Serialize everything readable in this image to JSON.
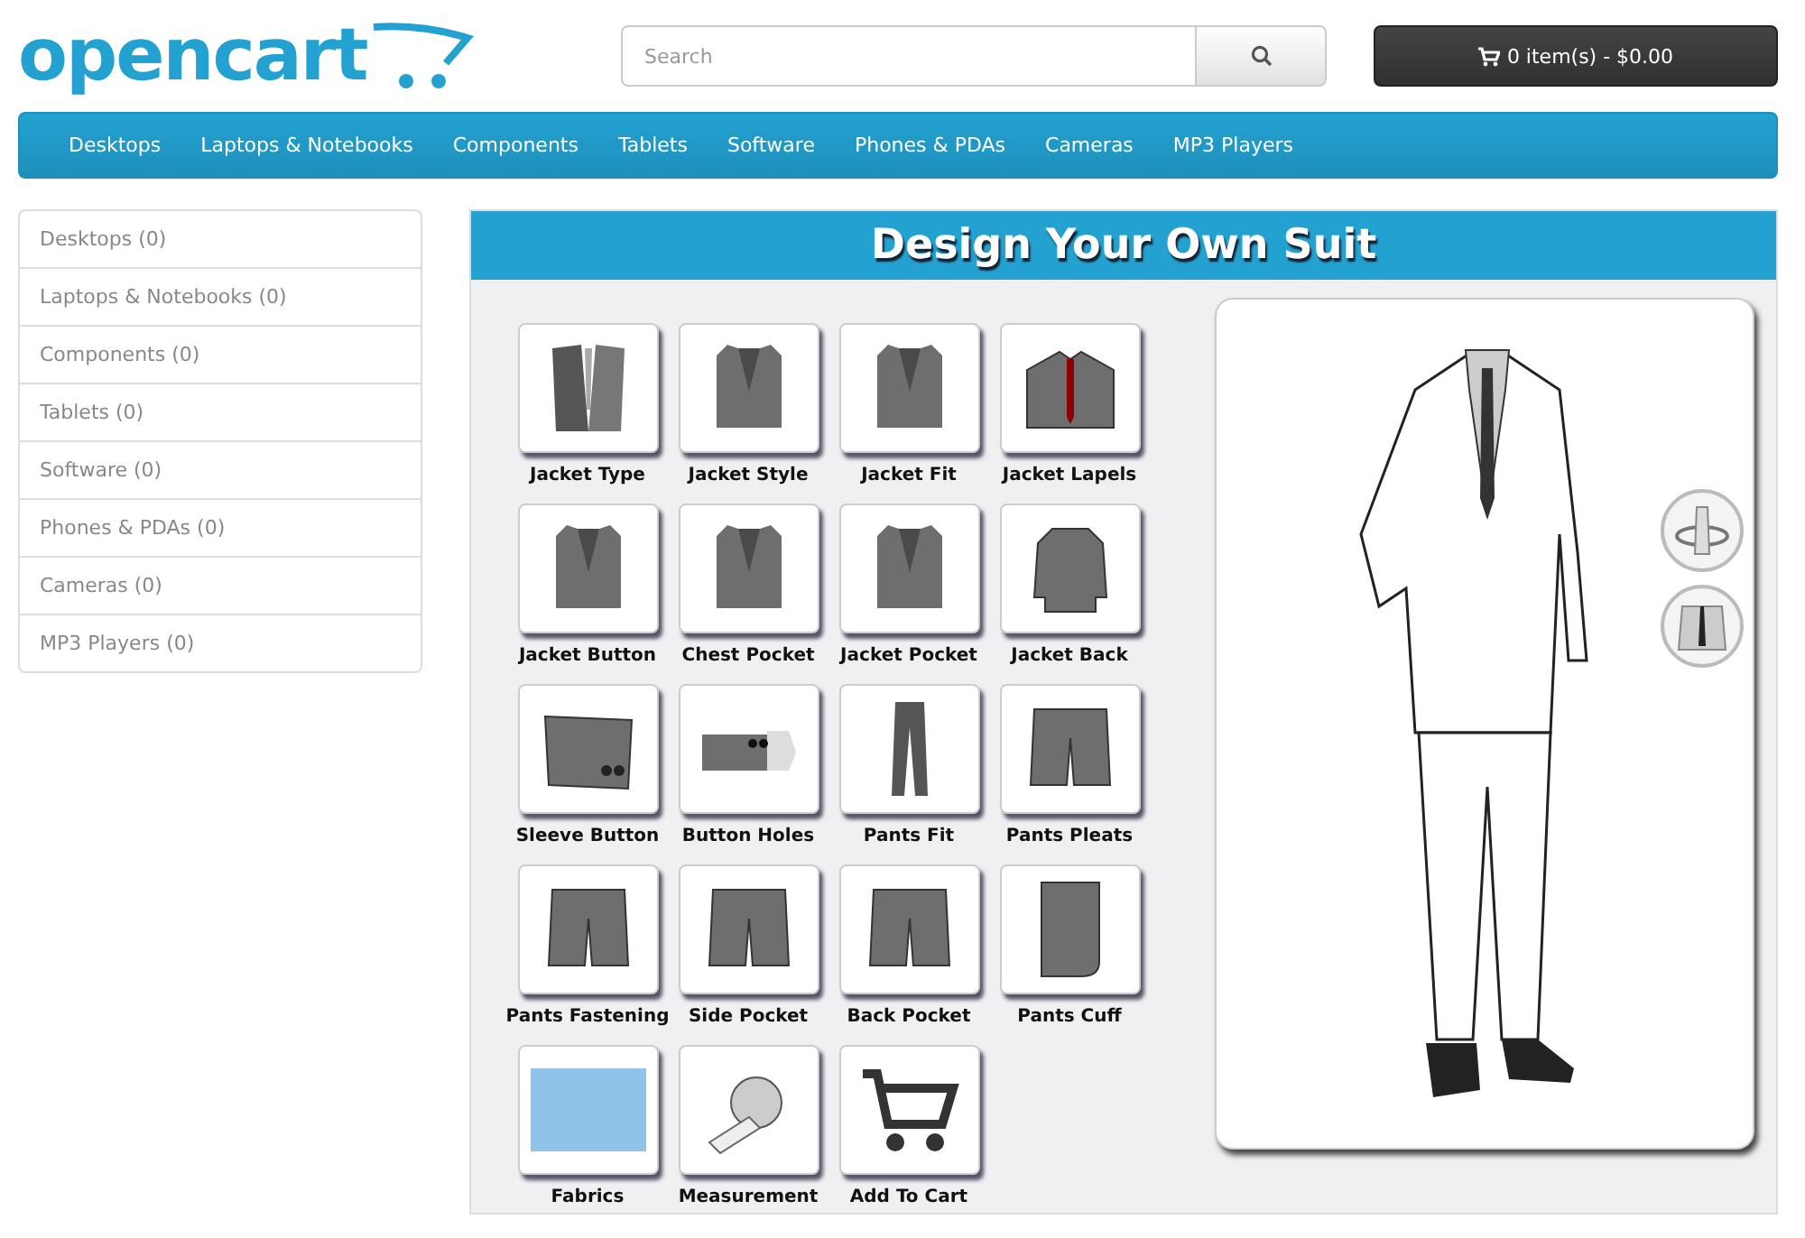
{
  "header": {
    "logo": "opencart",
    "search": {
      "placeholder": "Search"
    },
    "cart": "0 item(s) - $0.00"
  },
  "menu": [
    "Desktops",
    "Laptops & Notebooks",
    "Components",
    "Tablets",
    "Software",
    "Phones & PDAs",
    "Cameras",
    "MP3 Players"
  ],
  "sidebar": {
    "items": [
      "Desktops (0)",
      "Laptops & Notebooks (0)",
      "Components (0)",
      "Tablets (0)",
      "Software (0)",
      "Phones & PDAs (0)",
      "Cameras (0)",
      "MP3 Players (0)"
    ]
  },
  "designer": {
    "title": "Design Your Own Suit",
    "options": [
      {
        "label": "Jacket Type",
        "kind": "vest"
      },
      {
        "label": "Jacket Style",
        "kind": "jacket"
      },
      {
        "label": "Jacket Fit",
        "kind": "jacket"
      },
      {
        "label": "Jacket Lapels",
        "kind": "lapels"
      },
      {
        "label": "Jacket Button",
        "kind": "jacket"
      },
      {
        "label": "Chest Pocket",
        "kind": "jacket"
      },
      {
        "label": "Jacket Pocket",
        "kind": "jacket"
      },
      {
        "label": "Jacket Back",
        "kind": "back"
      },
      {
        "label": "Sleeve Button",
        "kind": "sleeve"
      },
      {
        "label": "Button Holes",
        "kind": "holes"
      },
      {
        "label": "Pants Fit",
        "kind": "pants"
      },
      {
        "label": "Pants Pleats",
        "kind": "shorts"
      },
      {
        "label": "Pants Fastening",
        "kind": "shorts"
      },
      {
        "label": "Side Pocket",
        "kind": "shorts"
      },
      {
        "label": "Back Pocket",
        "kind": "shorts"
      },
      {
        "label": "Pants Cuff",
        "kind": "cuff"
      },
      {
        "label": "Fabrics",
        "kind": "fabric"
      },
      {
        "label": "Measurement",
        "kind": "tape"
      },
      {
        "label": "Add To Cart",
        "kind": "cart"
      }
    ]
  }
}
